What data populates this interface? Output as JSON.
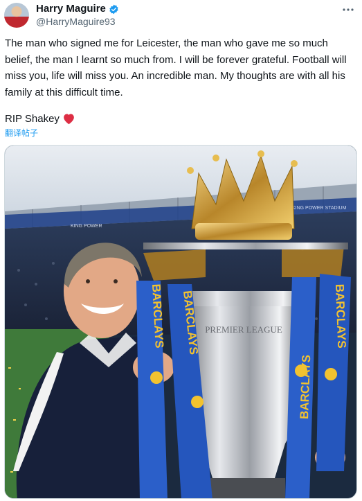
{
  "author": {
    "display_name": "Harry Maguire",
    "handle": "@HarryMaguire93",
    "verified": true
  },
  "tweet": {
    "body": "The man who signed me for Leicester, the man who gave me so much belief, the man I learnt so much from. I will be forever grateful. Football will miss you, life will miss you. An incredible man. My thoughts are with all his family at this difficult time.",
    "closing": "RIP Shakey"
  },
  "translate_link": "翻译帖子",
  "media": {
    "stadium_sign_left": "KING POWER",
    "stadium_sign_right": "KING POWER STADIUM",
    "trophy_text": "PREMIER LEAGUE",
    "ribbon_text": "BARCLAYS"
  },
  "colors": {
    "heart": "#e0245e",
    "link": "#1d9bf0",
    "verified": "#1d9bf0",
    "ribbon": "#2b5fc9",
    "ribbon_text": "#f2c230"
  },
  "icons": {
    "verified": "verified-badge-icon",
    "more": "more-dots-icon",
    "heart": "red-heart-icon"
  }
}
